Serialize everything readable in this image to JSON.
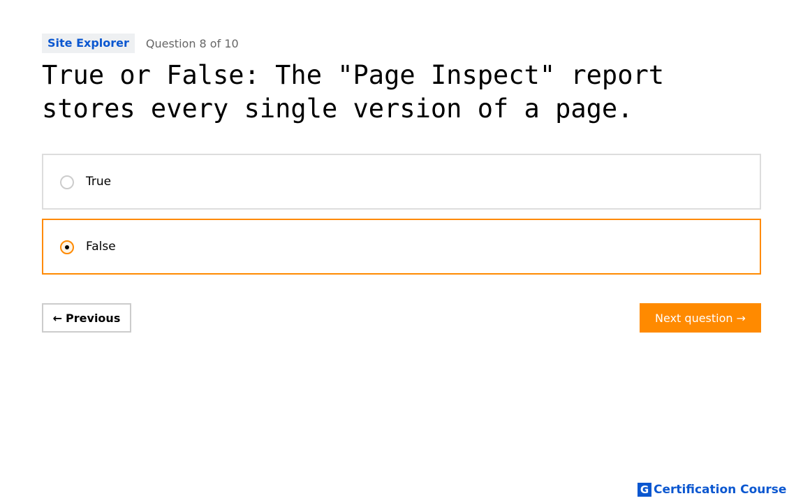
{
  "quiz": {
    "category": "Site Explorer",
    "progress": "Question 8 of 10",
    "question": "True or False: The \"Page Inspect\" report stores every single version of a page.",
    "options": [
      {
        "label": "True",
        "selected": false
      },
      {
        "label": "False",
        "selected": true
      }
    ]
  },
  "nav": {
    "prev_arrow": "←",
    "prev_label": "Previous",
    "next_label": "Next question",
    "next_arrow": "→"
  },
  "footer": {
    "logo_mark": "G",
    "logo_text": "Certification Course"
  },
  "colors": {
    "accent": "#ff8a00",
    "brand_blue": "#0b57d0",
    "border": "#dddddd",
    "muted_text": "#666666"
  },
  "icons": {
    "prev": "arrow-left-icon",
    "next": "arrow-right-icon",
    "radio": "radio-button-icon"
  }
}
